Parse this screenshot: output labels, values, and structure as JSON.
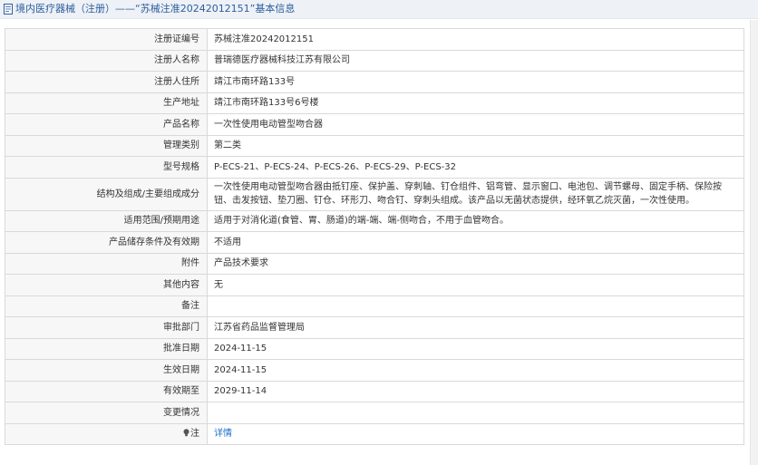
{
  "header": {
    "title": "境内医疗器械（注册）——“苏械注准20242012151”基本信息"
  },
  "rows": [
    {
      "label": "注册证编号",
      "value": "苏械注准20242012151"
    },
    {
      "label": "注册人名称",
      "value": "普瑞德医疗器械科技江苏有限公司"
    },
    {
      "label": "注册人住所",
      "value": "靖江市南环路133号"
    },
    {
      "label": "生产地址",
      "value": "靖江市南环路133号6号楼"
    },
    {
      "label": "产品名称",
      "value": "一次性使用电动管型吻合器"
    },
    {
      "label": "管理类别",
      "value": "第二类"
    },
    {
      "label": "型号规格",
      "value": "P-ECS-21、P-ECS-24、P-ECS-26、P-ECS-29、P-ECS-32"
    },
    {
      "label": "结构及组成/主要组成成分",
      "value": "一次性使用电动管型吻合器由抵钉座、保护盖、穿刺轴、钉仓组件、铝弯管、显示窗口、电池包、调节螺母、固定手柄、保险按钮、击发按钮、垫刀圈、钉仓、环形刀、吻合钉、穿刺头组成。该产品以无菌状态提供，经环氧乙烷灭菌，一次性使用。"
    },
    {
      "label": "适用范围/预期用途",
      "value": "适用于对消化道(食管、胃、肠道)的端-端、端-侧吻合，不用于血管吻合。"
    },
    {
      "label": "产品储存条件及有效期",
      "value": "不适用"
    },
    {
      "label": "附件",
      "value": "产品技术要求"
    },
    {
      "label": "其他内容",
      "value": "无"
    },
    {
      "label": "备注",
      "value": ""
    },
    {
      "label": "审批部门",
      "value": "江苏省药品监督管理局"
    },
    {
      "label": "批准日期",
      "value": "2024-11-15"
    },
    {
      "label": "生效日期",
      "value": "2024-11-15"
    },
    {
      "label": "有效期至",
      "value": "2029-11-14"
    },
    {
      "label": "变更情况",
      "value": ""
    },
    {
      "label": "注",
      "value": "详情"
    }
  ],
  "colors": {
    "header_bg": "#eef1f6",
    "header_text": "#2c5e9e",
    "link": "#1a6fc9",
    "border": "#d9d9d9"
  },
  "icons": {
    "header": "document-icon",
    "note": "bulb-icon"
  }
}
